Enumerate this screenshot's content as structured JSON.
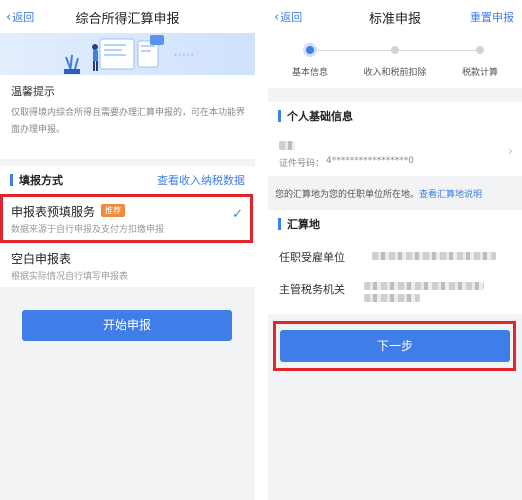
{
  "left": {
    "nav": {
      "back_label": "返回",
      "title": "综合所得汇算申报"
    },
    "banner": {
      "arrows": "‹‹‹‹‹"
    },
    "tips": {
      "heading": "温馨提示",
      "body": "仅取得境内综合所得且需要办理汇算申报的，可在本功能界面办理申报。"
    },
    "section": {
      "label": "填报方式",
      "link": "查看收入纳税数据"
    },
    "options": [
      {
        "title": "申报表预填服务",
        "badge": "推荐",
        "desc": "数据来源于自行申报及支付方扣缴申报",
        "selected": true
      },
      {
        "title": "空白申报表",
        "desc": "根据实际情况自行填写申报表",
        "selected": false
      }
    ],
    "start_button": "开始申报"
  },
  "right": {
    "nav": {
      "back_label": "返回",
      "title": "标准申报",
      "action": "重置申报"
    },
    "steps": [
      {
        "label": "基本信息",
        "active": true
      },
      {
        "label": "收入和税前扣除",
        "active": false
      },
      {
        "label": "税款计算",
        "active": false
      }
    ],
    "personal": {
      "heading": "个人基础信息",
      "id_label": "证件号码：",
      "id_value": "4*****************0"
    },
    "notice": {
      "text": "您的汇算地为您的任职单位所在地。",
      "link": "查看汇算地说明"
    },
    "settlement": {
      "heading": "汇算地",
      "employer_label": "任职受雇单位",
      "tax_authority_label": "主管税务机关"
    },
    "next_button": "下一步"
  },
  "colors": {
    "accent": "#3f7de8",
    "highlight": "#e0262b",
    "badge": "#f08a3c"
  },
  "icons": [
    "chevron-left-icon",
    "check-icon",
    "chevron-right-icon"
  ]
}
